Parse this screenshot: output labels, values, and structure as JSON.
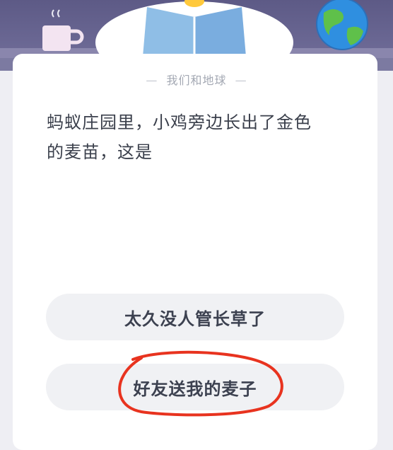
{
  "quiz": {
    "category": "我们和地球",
    "category_dash": "—",
    "question_line1": "蚂蚁庄园里，小鸡旁边长出了金色",
    "question_line2": "的麦苗，这是",
    "options": [
      {
        "label": "太久没人管长草了"
      },
      {
        "label": "好友送我的麦子"
      }
    ]
  },
  "annotation": {
    "circle_color": "#e8331f"
  },
  "icons": [
    "mug-icon",
    "chick-reading-icon",
    "earth-globe-icon"
  ]
}
